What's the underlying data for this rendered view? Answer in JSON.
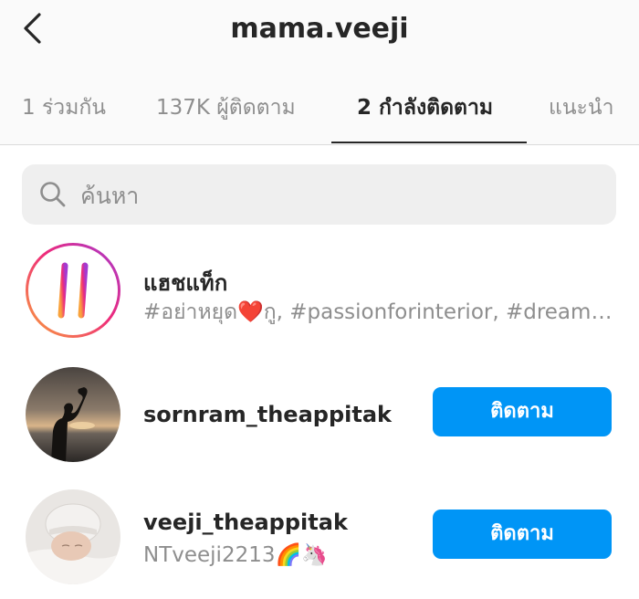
{
  "header": {
    "title": "mama.veeji",
    "back_icon": "chevron-left-icon"
  },
  "tabs": [
    {
      "label": "1 ร่วมกัน",
      "active": false
    },
    {
      "label": "137K ผู้ติดตาม",
      "active": false
    },
    {
      "label": "2 กำลังติดตาม",
      "active": true
    },
    {
      "label": "แนะนำ",
      "active": false
    }
  ],
  "search": {
    "placeholder": "ค้นหา",
    "icon": "search-icon"
  },
  "hashtags_row": {
    "title": "แฮชแท็ก",
    "subtitle": "#อย่าหยุด❤️กู, #passionforinterior, #dreamh…",
    "icon": "hashtag-icon"
  },
  "following": [
    {
      "username": "sornram_theappitak",
      "subtitle": "",
      "button_label": "ติดตาม",
      "avatar": "father-holding-baby-sunset-photo"
    },
    {
      "username": "veeji_theappitak",
      "subtitle": "NTveeji2213🌈🦄",
      "button_label": "ติดตาม",
      "avatar": "sleeping-baby-photo"
    }
  ],
  "colors": {
    "accent": "#0095f6",
    "text_primary": "#262626",
    "text_secondary": "#8e8e8e",
    "header_bg": "#fafafa",
    "search_bg": "#efefef"
  }
}
